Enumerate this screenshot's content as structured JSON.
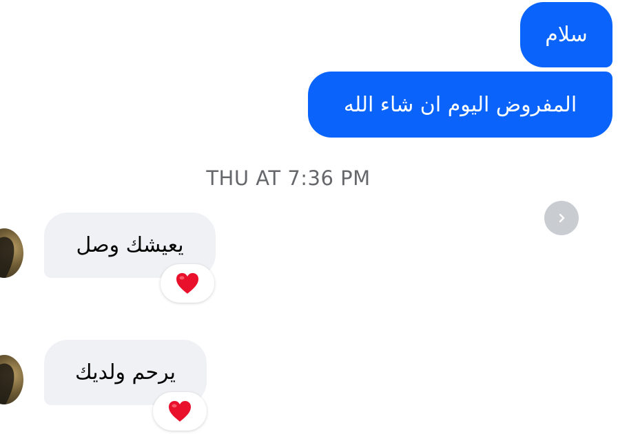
{
  "colors": {
    "outgoing_bubble": "#0a64fc",
    "incoming_bubble": "#f0f1f4",
    "reaction_heart": "#e8102a",
    "timestamp_text": "#65676b",
    "next_button": "#c9ccd1"
  },
  "messages_outgoing": [
    {
      "text": "سلام"
    },
    {
      "text": "المفروض اليوم ان شاء الله"
    }
  ],
  "timestamp": "THU AT 7:36 PM",
  "messages_incoming": [
    {
      "text": "يعيشك وصل",
      "reaction": "heart-icon"
    },
    {
      "text": "يرحم ولديك",
      "reaction": "heart-icon"
    }
  ],
  "icons": {
    "next": "chevron-right-icon",
    "avatar": "avatar"
  }
}
